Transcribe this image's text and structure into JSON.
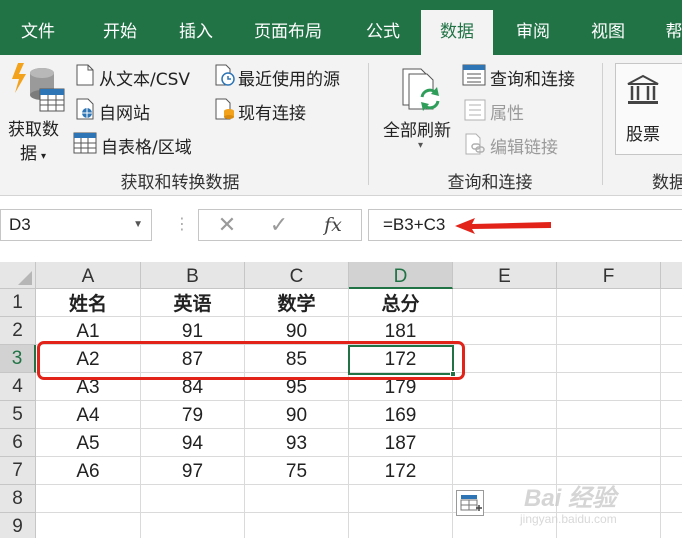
{
  "tabs": [
    {
      "label": "文件",
      "active": false
    },
    {
      "label": "开始",
      "active": false
    },
    {
      "label": "插入",
      "active": false
    },
    {
      "label": "页面布局",
      "active": false
    },
    {
      "label": "公式",
      "active": false
    },
    {
      "label": "数据",
      "active": true
    },
    {
      "label": "审阅",
      "active": false
    },
    {
      "label": "视图",
      "active": false
    },
    {
      "label": "帮",
      "active": false
    }
  ],
  "ribbon": {
    "get_data": {
      "label_line1": "获取数",
      "label_line2": "据"
    },
    "from_text_csv": "从文本/CSV",
    "from_web": "自网站",
    "from_table": "自表格/区域",
    "recent_sources": "最近使用的源",
    "existing_connections": "现有连接",
    "group_get_transform": "获取和转换数据",
    "refresh_all": "全部刷新",
    "queries_connections": "查询和连接",
    "properties": "属性",
    "edit_links": "编辑链接",
    "group_queries": "查询和连接",
    "stocks": "股票",
    "group_data_types": "数据"
  },
  "formula_bar": {
    "name_box": "D3",
    "cancel_symbol": "✕",
    "enter_symbol": "✓",
    "fx_label": "fx",
    "formula": "=B3+C3"
  },
  "columns": [
    "A",
    "B",
    "C",
    "D",
    "E",
    "F"
  ],
  "selected_column": "D",
  "selected_row": "3",
  "rows": [
    {
      "num": "1",
      "cells": [
        "姓名",
        "英语",
        "数学",
        "总分",
        "",
        ""
      ]
    },
    {
      "num": "2",
      "cells": [
        "A1",
        "91",
        "90",
        "181",
        "",
        ""
      ]
    },
    {
      "num": "3",
      "cells": [
        "A2",
        "87",
        "85",
        "172",
        "",
        ""
      ]
    },
    {
      "num": "4",
      "cells": [
        "A3",
        "84",
        "95",
        "179",
        "",
        ""
      ]
    },
    {
      "num": "5",
      "cells": [
        "A4",
        "79",
        "90",
        "169",
        "",
        ""
      ]
    },
    {
      "num": "6",
      "cells": [
        "A5",
        "94",
        "93",
        "187",
        "",
        ""
      ]
    },
    {
      "num": "7",
      "cells": [
        "A6",
        "97",
        "75",
        "172",
        "",
        ""
      ]
    },
    {
      "num": "8",
      "cells": [
        "",
        "",
        "",
        "",
        "",
        ""
      ]
    },
    {
      "num": "9",
      "cells": [
        "",
        "",
        "",
        "",
        "",
        ""
      ]
    }
  ],
  "colors": {
    "excel_green": "#217346",
    "annotation_red": "#e2231a",
    "ribbon_bg": "#f3f3f3"
  },
  "icons": {
    "get_data": "database-lightning-icon",
    "csv": "document-icon",
    "web": "web-page-icon",
    "table": "table-grid-icon",
    "recent": "clock-document-icon",
    "existing": "database-document-icon",
    "refresh": "refresh-icon",
    "queries": "list-panel-icon",
    "properties": "properties-icon",
    "edit_links": "chain-link-icon",
    "stocks": "bank-building-icon",
    "quick_analysis": "quick-analysis-icon",
    "arrow": "red-arrow-icon"
  },
  "watermark": {
    "main": "Bai 经验",
    "sub": "jingyan.baidu.com"
  }
}
